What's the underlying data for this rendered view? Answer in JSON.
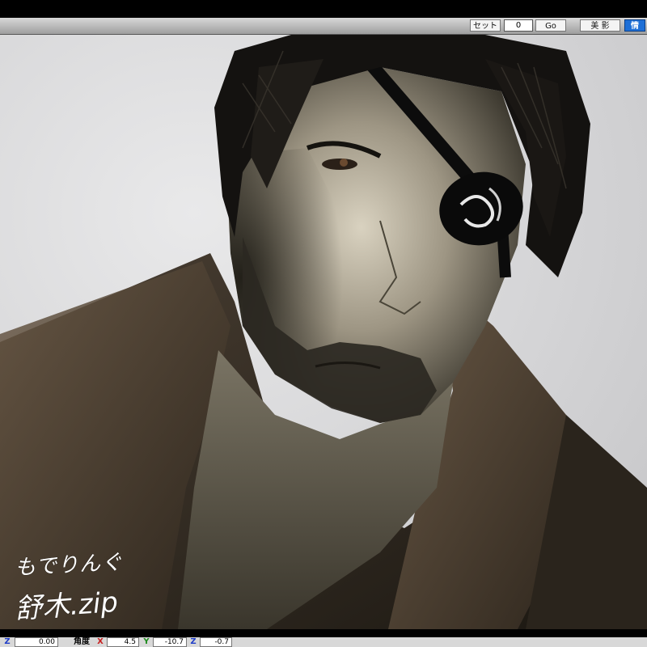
{
  "toolbar": {
    "set_label": "セット",
    "frame_value": "0",
    "go_label": "Go",
    "beauty_label": "美 影",
    "info_label": "情"
  },
  "viewport": {
    "signature_line1": "もでりんぐ",
    "signature_line2": "舒木.zip"
  },
  "statusbar": {
    "z_label": "Z",
    "z_value": "0.00",
    "angle_label": "角度",
    "x_label": "X",
    "x_value": "4.5",
    "y_label": "Y",
    "y_value": "-10.7",
    "z2_label": "Z",
    "z2_value": "-0.7"
  },
  "colors": {
    "active_tab": "#1e6fd6",
    "x_axis": "#c81e1e",
    "y_axis": "#1e8c1e",
    "z_axis": "#1e3cc8"
  }
}
